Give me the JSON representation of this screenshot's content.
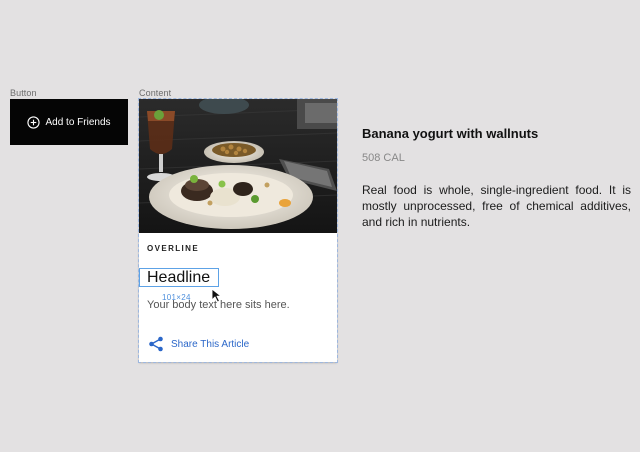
{
  "frames": {
    "button_label": "Button",
    "content_label": "Content"
  },
  "button": {
    "label": "Add to Friends",
    "icon": "plus-circle-icon"
  },
  "card": {
    "image_alt": "food-photo",
    "overline": "OVERLINE",
    "headline": "Headline",
    "selection_size": "101×24",
    "body": "Your body text here sits here.",
    "share_label": "Share This Article",
    "share_icon": "share-icon",
    "accent": "#2b67c9",
    "selection_color": "#5da2e6"
  },
  "article": {
    "title": "Banana yogurt with wallnuts",
    "calories": "508 CAL",
    "description": "Real food is whole, single-ingredient food. It is mostly unprocessed, free of chemical additives, and rich in nutrients."
  }
}
